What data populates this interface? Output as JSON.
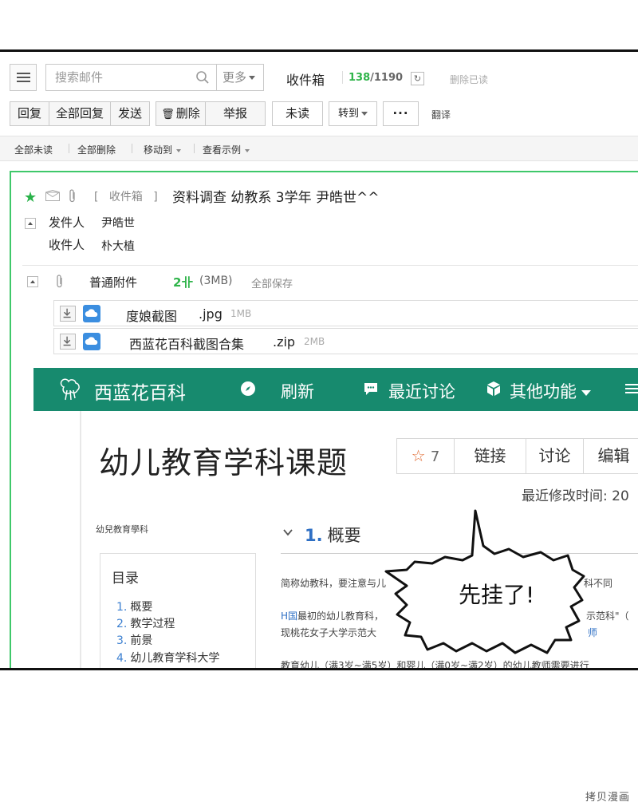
{
  "toolbar": {
    "search_placeholder": "搜索邮件",
    "more_label": "更多",
    "folder_title": "收件箱",
    "unread_count": "138",
    "count_separator": "/",
    "total_count": "1190",
    "refresh_glyph": "↻",
    "delete_read_label": "删除已读",
    "reply_label": "回复",
    "reply_all_label": "全部回复",
    "send_label": "发送",
    "delete_label": "删除",
    "report_label": "举报",
    "unread_label": "未读",
    "move_to_label": "转到",
    "more_dots": "···",
    "translate_label": "翻译"
  },
  "subbar": {
    "all_unread": "全部未读",
    "delete_all": "全部删除",
    "move_to": "移动到",
    "view_example": "查看示例"
  },
  "mail": {
    "folder_open": "[",
    "folder": "收件箱",
    "folder_close": "]",
    "subject": "资料调查 幼教系 3学年 尹皓世^^",
    "from_label": "发件人",
    "from_value": "尹皓世",
    "to_label": "收件人",
    "to_value": "朴大植",
    "attachments_title": "普通附件",
    "attachments_count": "2卝",
    "attachments_size": "(3MB)",
    "save_all": "全部保存",
    "files": [
      {
        "name": "度娘截图",
        "ext": ".jpg",
        "size": "1MB"
      },
      {
        "name": "西蓝花百科截图合集",
        "ext": ".zip",
        "size": "2MB"
      }
    ]
  },
  "wiki": {
    "site_name": "西蓝花百科",
    "nav": [
      "刷新",
      "最近讨论",
      "其他功能"
    ],
    "title": "幼儿教育学科课题",
    "star_count": "7",
    "star_glyph": "☆",
    "buttons": [
      "链接",
      "讨论",
      "编辑"
    ],
    "modified_label": "最近修改时间: 20",
    "category": "幼兒教育學科",
    "toc_title": "目录",
    "toc": [
      {
        "num": "1.",
        "label": "概要"
      },
      {
        "num": "2.",
        "label": "教学过程"
      },
      {
        "num": "3.",
        "label": "前景"
      },
      {
        "num": "4.",
        "label": "幼儿教育学科大学"
      }
    ],
    "section_num": "1.",
    "section_title": "概要",
    "para1": "简称幼教科，要注意与儿",
    "para1_tail": "科不同",
    "para2_link": "H国",
    "para2": "最初的幼儿教育科，",
    "para2_tail": "示范科\"（",
    "para3": "现桃花女子大学示范大",
    "para3_tail": "师",
    "para4": "教育幼儿（满3岁~满5岁）和婴儿（满0岁~满2岁）的幼儿教师需要进行"
  },
  "bubble": {
    "text": "先挂了!"
  },
  "watermark": "拷贝漫画",
  "colors": {
    "accent_green": "#2fb44a",
    "wiki_nav": "#178a6e",
    "link_blue": "#2e6fc4"
  }
}
